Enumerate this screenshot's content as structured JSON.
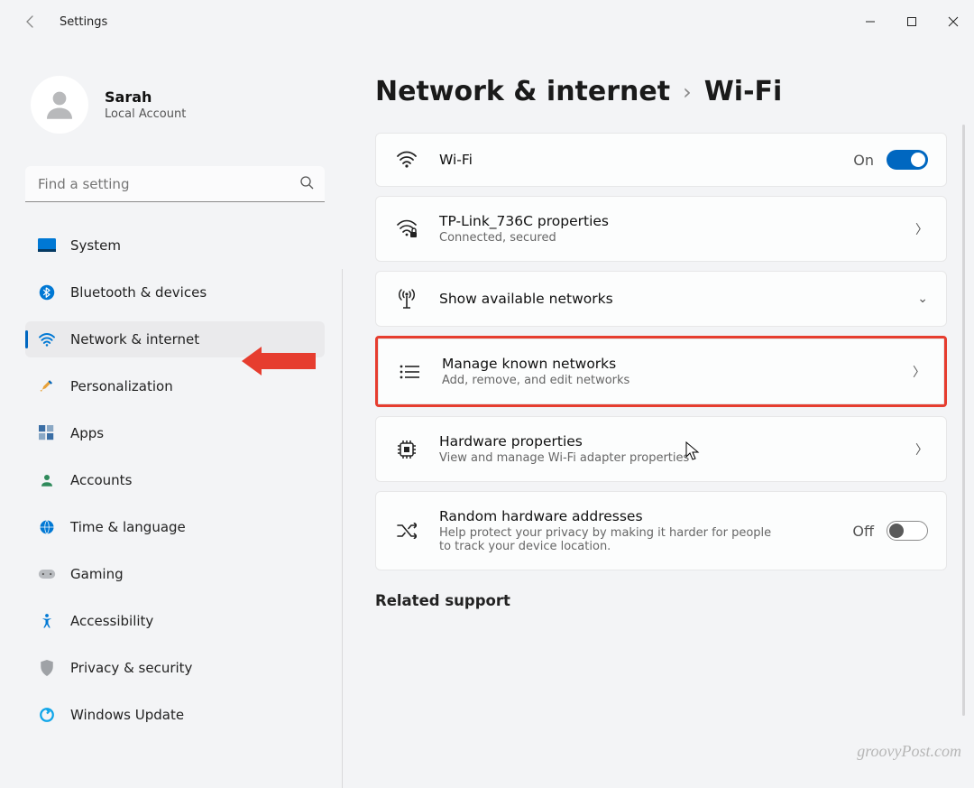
{
  "window": {
    "title": "Settings"
  },
  "user": {
    "name": "Sarah",
    "subtitle": "Local Account"
  },
  "search": {
    "placeholder": "Find a setting"
  },
  "sidebar": {
    "items": [
      {
        "label": "System"
      },
      {
        "label": "Bluetooth & devices"
      },
      {
        "label": "Network & internet"
      },
      {
        "label": "Personalization"
      },
      {
        "label": "Apps"
      },
      {
        "label": "Accounts"
      },
      {
        "label": "Time & language"
      },
      {
        "label": "Gaming"
      },
      {
        "label": "Accessibility"
      },
      {
        "label": "Privacy & security"
      },
      {
        "label": "Windows Update"
      }
    ],
    "selected_index": 2
  },
  "breadcrumb": {
    "a": "Network & internet",
    "b": "Wi-Fi"
  },
  "cards": {
    "wifi": {
      "title": "Wi-Fi",
      "state": "On"
    },
    "conn": {
      "title": "TP-Link_736C properties",
      "sub": "Connected, secured"
    },
    "avail": {
      "title": "Show available networks"
    },
    "known": {
      "title": "Manage known networks",
      "sub": "Add, remove, and edit networks"
    },
    "hw": {
      "title": "Hardware properties",
      "sub": "View and manage Wi-Fi adapter properties"
    },
    "rand": {
      "title": "Random hardware addresses",
      "sub": "Help protect your privacy by making it harder for people to track your device location.",
      "state": "Off"
    }
  },
  "related": {
    "heading": "Related support"
  },
  "watermark": "groovyPost.com",
  "colors": {
    "accent": "#0067c0",
    "highlight": "#e63d2f"
  }
}
